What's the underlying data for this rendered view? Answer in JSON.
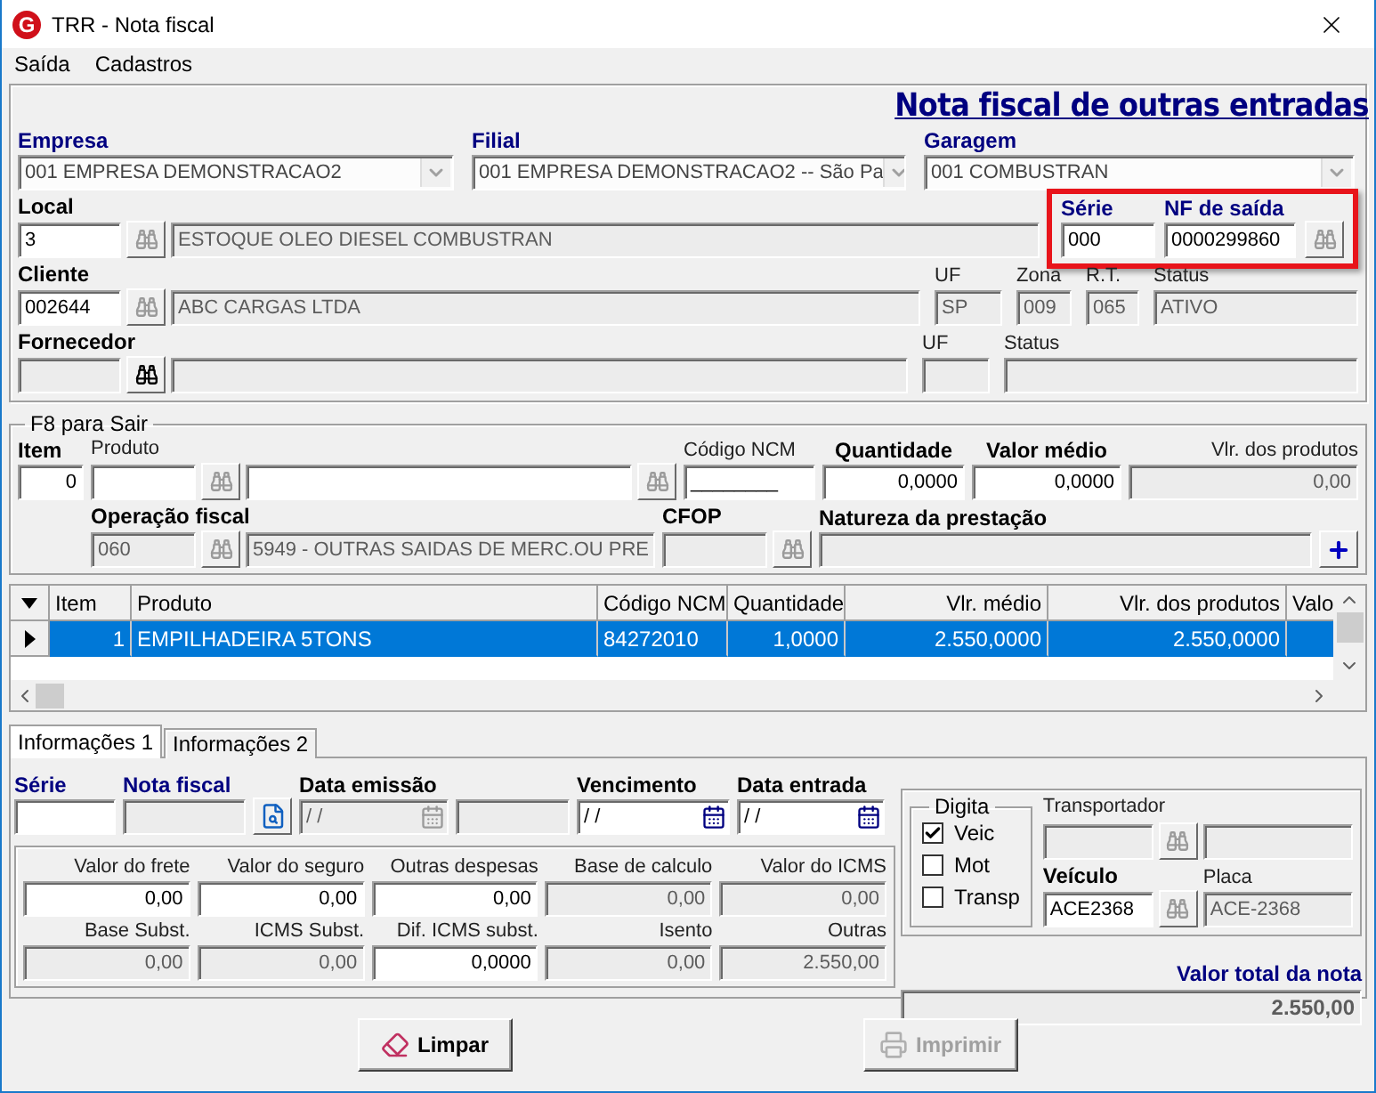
{
  "window": {
    "logo": "G",
    "title": "TRR - Nota fiscal"
  },
  "menu": [
    "Saída",
    "Cadastros"
  ],
  "heading": "Nota fiscal de outras entradas",
  "empresa": {
    "label": "Empresa",
    "value": "001 EMPRESA DEMONSTRACAO2",
    "disabled": true
  },
  "filial": {
    "label": "Filial",
    "value": "001 EMPRESA DEMONSTRACAO2 -- São Pa",
    "disabled": true
  },
  "garagem": {
    "label": "Garagem",
    "value": "001 COMBUSTRAN",
    "disabled": true
  },
  "local": {
    "label": "Local",
    "code": {
      "value": "3",
      "disabled": false
    },
    "description": {
      "value": "ESTOQUE OLEO DIESEL COMBUSTRAN",
      "disabled": true
    }
  },
  "nf_saida": {
    "highlighted": true,
    "serie": {
      "label": "Série",
      "value": "000",
      "disabled": false
    },
    "numero": {
      "label": "NF de saída",
      "value": "0000299860",
      "disabled": false
    }
  },
  "cliente": {
    "label": "Cliente",
    "code": {
      "value": "002644",
      "disabled": false
    },
    "name": {
      "value": "ABC CARGAS LTDA",
      "disabled": true
    },
    "uf": {
      "label": "UF",
      "value": "SP",
      "disabled": true
    },
    "zona": {
      "label": "Zona",
      "value": "009",
      "disabled": true
    },
    "rt": {
      "label": "R.T.",
      "value": "065",
      "disabled": true
    },
    "status": {
      "label": "Status",
      "value": "ATIVO",
      "disabled": true
    }
  },
  "fornecedor": {
    "label": "Fornecedor",
    "code": {
      "disabled": true
    },
    "name": {
      "disabled": true
    },
    "uf": {
      "label": "UF",
      "disabled": true
    },
    "status": {
      "label": "Status",
      "disabled": true
    }
  },
  "item_entry": {
    "legend": "F8 para Sair",
    "item": {
      "label": "Item",
      "value": "0",
      "disabled": false
    },
    "produto": {
      "label": "Produto",
      "disabled": false
    },
    "produto_desc": {
      "disabled": false
    },
    "ncm": {
      "label": "Código NCM",
      "value": "________",
      "disabled": false
    },
    "quantidade": {
      "label": "Quantidade",
      "value": "0,0000",
      "disabled": false
    },
    "valor_medio": {
      "label": "Valor médio",
      "value": "0,0000",
      "disabled": false
    },
    "vlr_produtos": {
      "label": "Vlr. dos produtos",
      "value": "0,00",
      "disabled": true
    },
    "operacao": {
      "label": "Operação fiscal",
      "value": "060",
      "disabled": true
    },
    "operacao_desc": {
      "value": "5949 - OUTRAS SAIDAS DE MERC.OU PRE",
      "disabled": true
    },
    "cfop": {
      "label": "CFOP",
      "disabled": true
    },
    "natureza": {
      "label": "Natureza da prestação",
      "disabled": true
    }
  },
  "grid": {
    "columns": [
      "Item",
      "Produto",
      "Código NCM",
      "Quantidade",
      "Vlr. médio",
      "Vlr. dos produtos",
      "Valo"
    ],
    "rows": [
      {
        "selected": true,
        "cells": [
          "1",
          "EMPILHADEIRA 5TONS",
          "84272010",
          "1,0000",
          "2.550,0000",
          "2.550,0000"
        ]
      }
    ]
  },
  "tabs": [
    {
      "label": "Informações 1",
      "selected": true
    },
    {
      "label": "Informações 2",
      "selected": false
    }
  ],
  "doc": {
    "serie": {
      "label": "Série",
      "disabled": false
    },
    "nota_fiscal": {
      "label": "Nota fiscal",
      "disabled": true
    },
    "data_emissao": {
      "label": "Data emissão",
      "value": "/ /",
      "disabled": true
    },
    "extra": {
      "disabled": true
    },
    "vencimento": {
      "label": "Vencimento",
      "value": "/ /",
      "disabled": false
    },
    "data_entrada": {
      "label": "Data entrada",
      "value": "/ /",
      "disabled": false
    }
  },
  "values": [
    {
      "label": "Valor do frete",
      "value": "0,00",
      "disabled": false
    },
    {
      "label": "Valor do seguro",
      "value": "0,00",
      "disabled": false
    },
    {
      "label": "Outras despesas",
      "value": "0,00",
      "disabled": false
    },
    {
      "label": "Base de calculo",
      "value": "0,00",
      "disabled": true
    },
    {
      "label": "Valor do ICMS",
      "value": "0,00",
      "disabled": true
    },
    {
      "label": "Base Subst.",
      "value": "0,00",
      "disabled": true
    },
    {
      "label": "ICMS Subst.",
      "value": "0,00",
      "disabled": true
    },
    {
      "label": "Dif. ICMS subst.",
      "value": "0,0000",
      "disabled": false
    },
    {
      "label": "Isento",
      "value": "0,00",
      "disabled": true
    },
    {
      "label": "Outras",
      "value": "2.550,00",
      "disabled": true
    }
  ],
  "digita": {
    "legend": "Digita",
    "options": [
      {
        "label": "Veic",
        "checked": true
      },
      {
        "label": "Mot",
        "checked": false
      },
      {
        "label": "Transp",
        "checked": false
      }
    ]
  },
  "transportador": {
    "label": "Transportador",
    "code": {
      "disabled": true
    },
    "name": {
      "disabled": true
    }
  },
  "veiculo": {
    "label": "Veículo",
    "value": "ACE2368",
    "disabled": false
  },
  "placa": {
    "label": "Placa",
    "value": "ACE-2368",
    "disabled": true
  },
  "total": {
    "label": "Valor total da nota",
    "value": "2.550,00",
    "disabled": true
  },
  "buttons": [
    {
      "kind": "clear",
      "label": "Limpar",
      "disabled": false
    },
    {
      "kind": "print",
      "label": "Imprimir",
      "disabled": true
    }
  ]
}
